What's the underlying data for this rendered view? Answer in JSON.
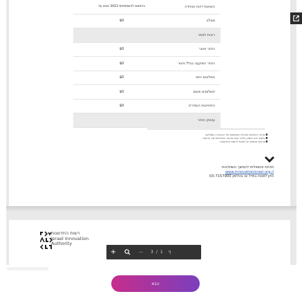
{
  "table": {
    "header": {
      "value_col": "בהתאם להשתתפות 2023 יוצאו עד",
      "label_col": "הוצאות דיווח ואחידה"
    },
    "rows": [
      {
        "value": "$0",
        "label": "מטלב",
        "shaded": false
      },
      {
        "value": "",
        "label": "ריבית לספר",
        "shaded": true
      },
      {
        "value": "$0",
        "label": "החזר פטור",
        "shaded": false
      },
      {
        "value": "$0",
        "label": "החזר השקעה בגלל ניטור",
        "shaded": false
      },
      {
        "value": "$0",
        "label": "תמלוגים ייחס",
        "shaded": false
      },
      {
        "value": "$0",
        "label": "תשלומים פטום",
        "shaded": false
      },
      {
        "value": "$0",
        "label": "התחייבות הוסדרת",
        "shaded": false
      },
      {
        "value": "",
        "label": "עיסוק החזר",
        "shaded": true
      }
    ]
  },
  "notes": {
    "line1": "הערות: הנתונים בטבלה מבוססים על ההצהרה שמולאה",
    "line2": "החישוב הוא אומדן בלבד ואינו מהווה התחייבות של הרשות",
    "line3": "לפרטים נוספים יש לפנות לרשות החדשנות"
  },
  "contact": {
    "line1": "תהיות והשאלות להמשך השתלבות",
    "link": "www.innovationisrael.org.il",
    "line3": "ניתן לפנות במייל או בטלפון 03-7157900"
  },
  "logo": {
    "line1": "רשות החדשנות",
    "line2": "Israel Innovation",
    "line3": "Authority"
  },
  "toolbar": {
    "zoom_in": "+",
    "search": "🔍",
    "zoom_out": "—",
    "page_current": "3",
    "page_sep": "/",
    "page_total": "1",
    "extra": "ף"
  },
  "next_button": {
    "label": "הבא"
  }
}
